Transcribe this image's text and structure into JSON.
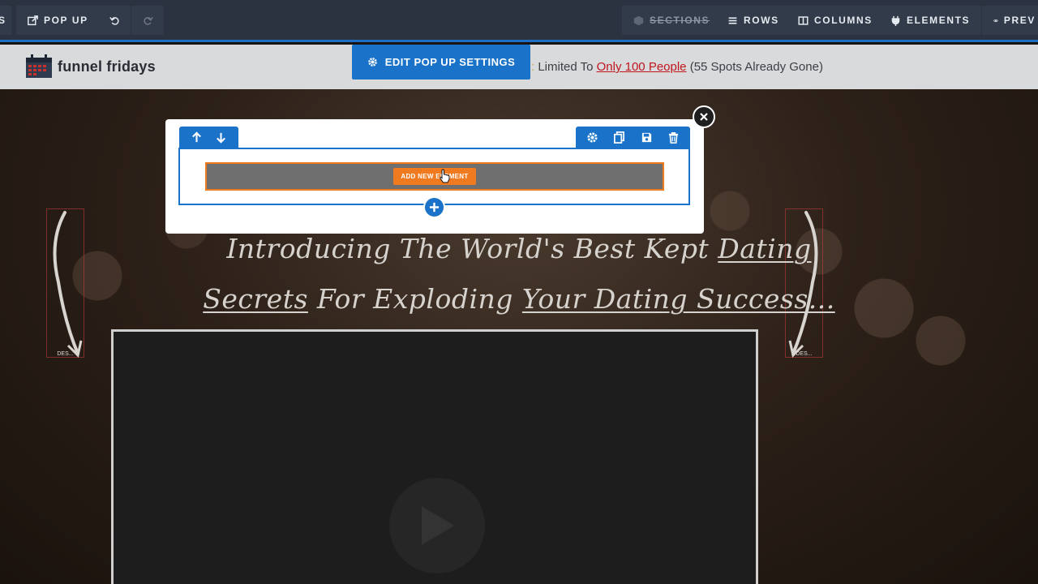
{
  "toolbar": {
    "left_cut_label": "S",
    "popup_label": "POP UP",
    "sections_label": "SECTIONS",
    "rows_label": "ROWS",
    "columns_label": "COLUMNS",
    "elements_label": "ELEMENTS",
    "preview_label": "PREV",
    "icons": [
      "popup-icon",
      "undo-icon",
      "redo-icon",
      "cube-icon",
      "rows-icon",
      "columns-icon",
      "elements-icon",
      "eye-icon"
    ]
  },
  "header": {
    "logo_text": "funnel fridays",
    "announce_colon": ":",
    "announce_prefix": " Limited To ",
    "announce_highlight": "Only 100 People",
    "announce_suffix": " (55 Spots Already Gone)"
  },
  "edit_popup": {
    "label": "EDIT POP UP SETTINGS"
  },
  "popup": {
    "add_element_label": "ADD NEW ELEMENT"
  },
  "headline": {
    "line1_plain": "Introducing The World's Best Kept ",
    "line1_underline": "Dating",
    "line2_underline1": "Secrets",
    "line2_plain": " For Exploding ",
    "line2_underline2": "Your Dating Success..."
  },
  "arrow_labels": {
    "left": "DES...",
    "right": "DES..."
  },
  "colors": {
    "accent": "#1a73c8",
    "orange": "#f07a1f",
    "topbar": "#2b3340",
    "highlight": "#c0161d"
  }
}
